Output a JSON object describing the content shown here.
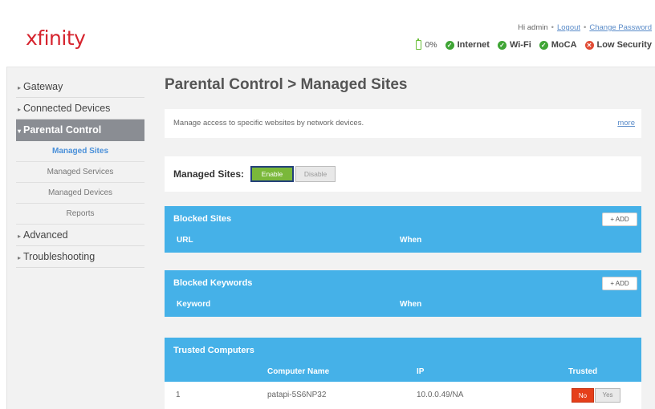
{
  "header": {
    "logo": "xfinity",
    "greeting": "Hi admin",
    "logout": "Logout",
    "change_password": "Change Password",
    "status": {
      "battery": "0%",
      "internet": "Internet",
      "wifi": "Wi-Fi",
      "moca": "MoCA",
      "security": "Low Security"
    }
  },
  "sidebar": {
    "items": [
      {
        "label": "Gateway"
      },
      {
        "label": "Connected Devices"
      },
      {
        "label": "Parental Control"
      },
      {
        "label": "Advanced"
      },
      {
        "label": "Troubleshooting"
      }
    ],
    "subitems": [
      {
        "label": "Managed Sites"
      },
      {
        "label": "Managed Services"
      },
      {
        "label": "Managed Devices"
      },
      {
        "label": "Reports"
      }
    ]
  },
  "main": {
    "title": "Parental Control > Managed Sites",
    "intro": "Manage access to specific websites by network devices.",
    "more": "more",
    "toggle": {
      "label": "Managed Sites:",
      "enable": "Enable",
      "disable": "Disable"
    },
    "blocked_sites": {
      "title": "Blocked Sites",
      "add": "+ ADD",
      "columns": [
        "URL",
        "When"
      ]
    },
    "blocked_keywords": {
      "title": "Blocked Keywords",
      "add": "+ ADD",
      "columns": [
        "Keyword",
        "When"
      ]
    },
    "trusted": {
      "title": "Trusted Computers",
      "columns": [
        "Computer Name",
        "IP",
        "Trusted"
      ],
      "rows": [
        {
          "index": "1",
          "name": "patapi-5S6NP32",
          "ip": "10.0.0.49/NA",
          "no": "No",
          "yes": "Yes"
        }
      ]
    }
  },
  "colors": {
    "brand_red": "#d6242e",
    "panel_blue": "#45b1e8",
    "enable_green": "#7ab83a",
    "no_red": "#e53f1a",
    "active_nav": "#8a8d93"
  }
}
